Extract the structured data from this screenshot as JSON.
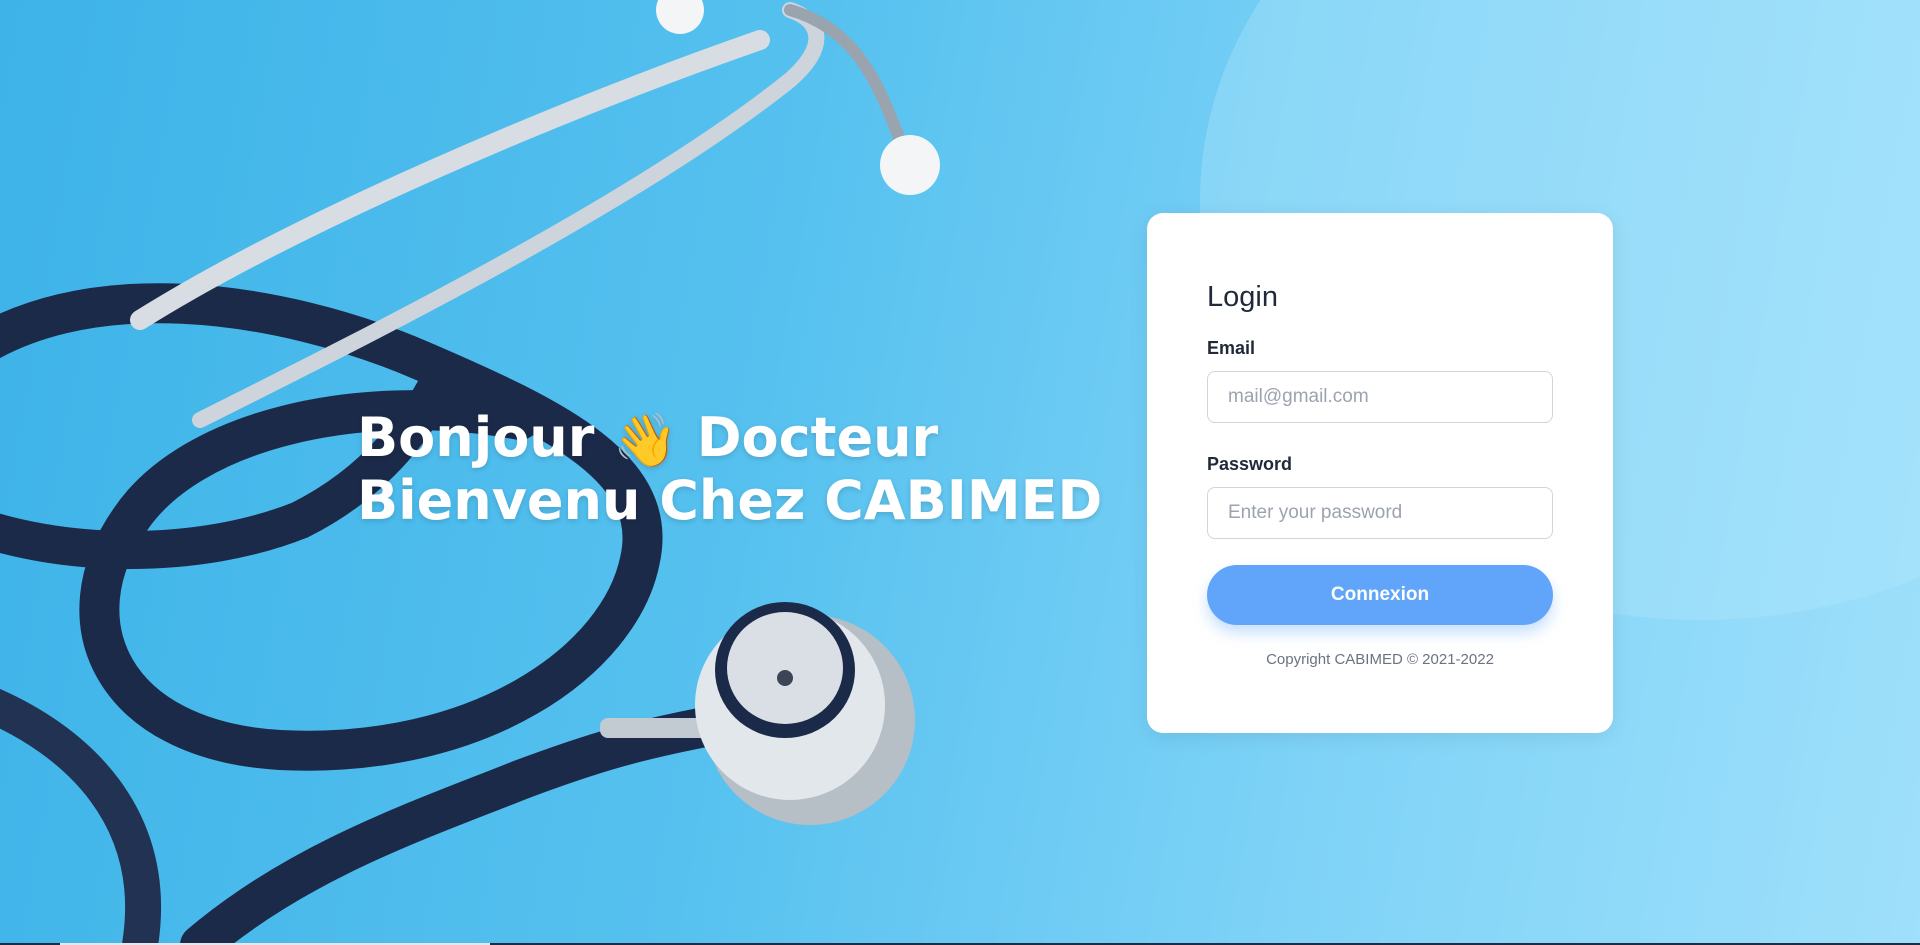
{
  "hero": {
    "line1_before": "Bonjour ",
    "wave_glyph": "👋",
    "line1_after": " Docteur",
    "line2": "Bienvenu Chez CABIMED"
  },
  "login": {
    "title": "Login",
    "email_label": "Email",
    "email_placeholder": "mail@gmail.com",
    "email_value": "",
    "password_label": "Password",
    "password_placeholder": "Enter your password",
    "password_value": "",
    "submit_label": "Connexion",
    "copyright": "Copyright CABIMED © 2021-2022"
  },
  "icons": {
    "hero_wave": "waving-hand-icon",
    "background": "stethoscope-illustration"
  },
  "colors": {
    "background": "#56c1ef",
    "card": "#ffffff",
    "button": "#60a5fa",
    "title_text": "#1f2937",
    "muted_text": "#6b7280"
  }
}
